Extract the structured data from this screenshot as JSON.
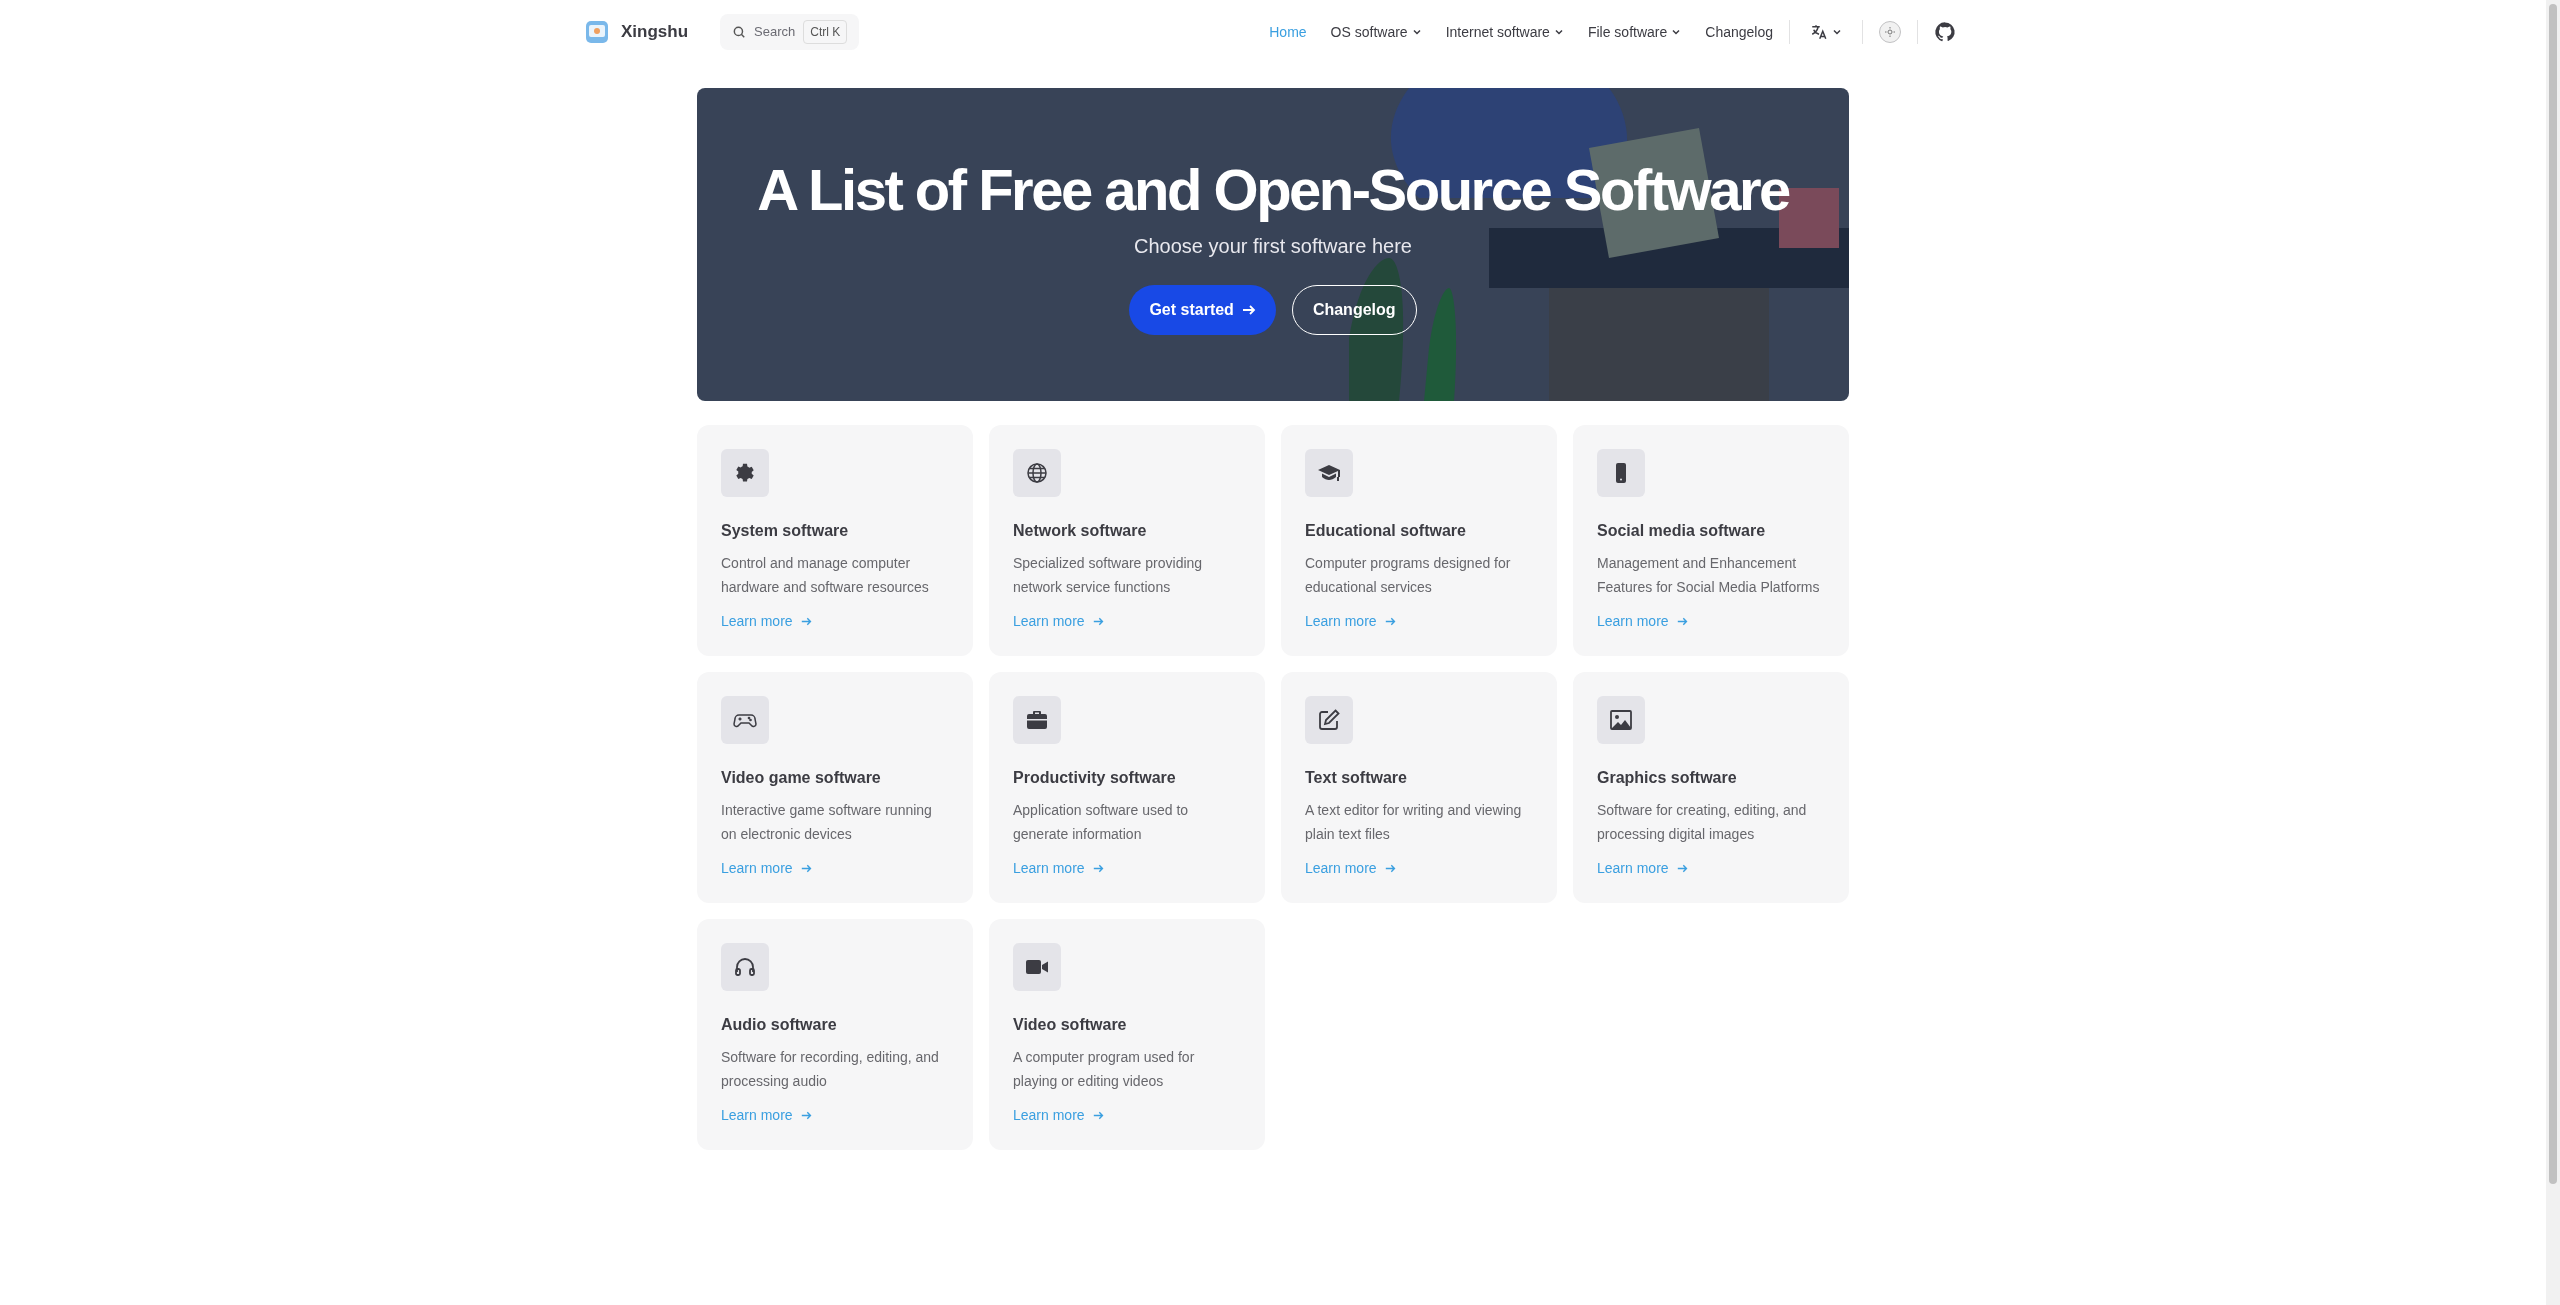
{
  "site": {
    "name": "Xingshu"
  },
  "search": {
    "placeholder": "Search",
    "shortcut": "Ctrl K"
  },
  "nav": [
    {
      "label": "Home",
      "selected": true,
      "kind": "link"
    },
    {
      "label": "OS software",
      "selected": false,
      "kind": "dropdown"
    },
    {
      "label": "Internet software",
      "selected": false,
      "kind": "dropdown"
    },
    {
      "label": "File software",
      "selected": false,
      "kind": "dropdown"
    },
    {
      "label": "Changelog",
      "selected": false,
      "kind": "link"
    }
  ],
  "hero": {
    "title": "A List of Free and Open-Source Software",
    "subtitle": "Choose your first software here",
    "buttons": [
      {
        "label": "Get started",
        "kind": "primary"
      },
      {
        "label": "Changelog",
        "kind": "outline"
      }
    ]
  },
  "cards": [
    {
      "title": "System software",
      "description": "Control and manage computer hardware and software resources",
      "link": "Learn more"
    },
    {
      "title": "Network software",
      "description": "Specialized software providing network service functions",
      "link": "Learn more"
    },
    {
      "title": "Educational software",
      "description": "Computer programs designed for educational services",
      "link": "Learn more"
    },
    {
      "title": "Social media software",
      "description": "Management and Enhancement Features for Social Media Platforms",
      "link": "Learn more"
    },
    {
      "title": "Video game software",
      "description": "Interactive game software running on electronic devices",
      "link": "Learn more"
    },
    {
      "title": "Productivity software",
      "description": "Application software used to generate information",
      "link": "Learn more"
    },
    {
      "title": "Text software",
      "description": "A text editor for writing and viewing plain text files",
      "link": "Learn more"
    },
    {
      "title": "Graphics software",
      "description": "Software for creating, editing, and processing digital images",
      "link": "Learn more"
    },
    {
      "title": "Audio software",
      "description": "Software for recording, editing, and processing audio",
      "link": "Learn more"
    },
    {
      "title": "Video software",
      "description": "A computer program used for playing or editing videos",
      "link": "Learn more"
    }
  ]
}
